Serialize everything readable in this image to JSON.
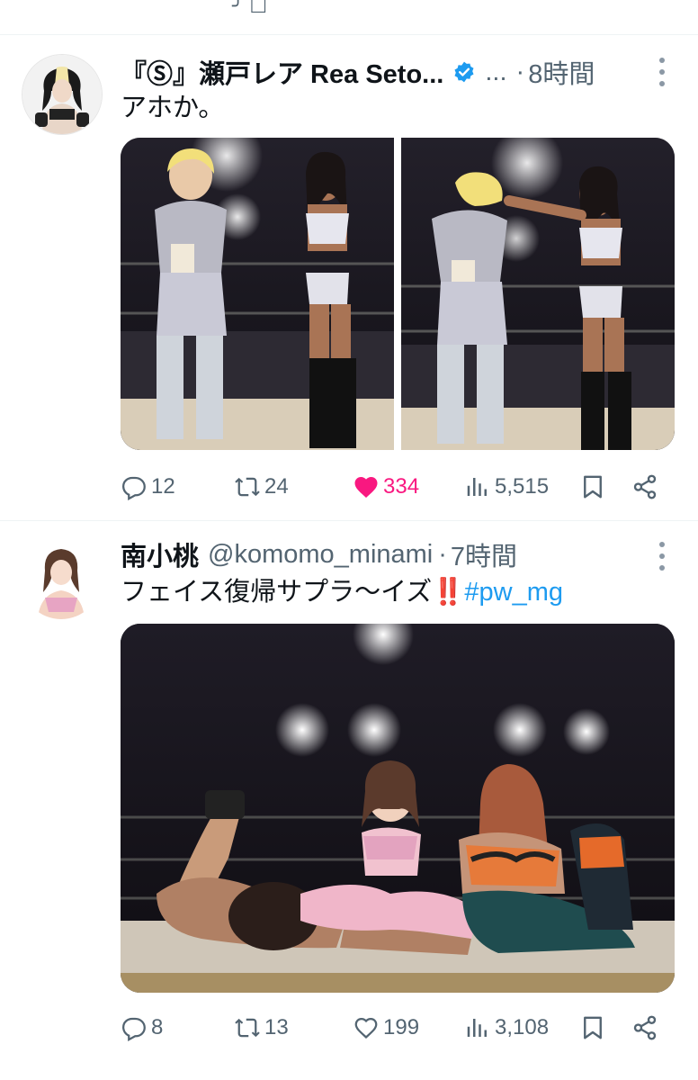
{
  "tweets": [
    {
      "display_name": "『Ⓢ』瀬戸レア Rea Seto...",
      "verified": true,
      "ellipsis": "...",
      "separator": "·",
      "time": "8時間",
      "text": "アホか。",
      "metrics": {
        "replies": "12",
        "retweets": "24",
        "likes": "334",
        "views": "5,515"
      },
      "liked": true
    },
    {
      "display_name": "南小桃",
      "handle": "@komomo_minami",
      "separator": "·",
      "time": "7時間",
      "text": "フェイス復帰サプラ〜イズ",
      "emoji": "‼️",
      "hashtag": "#pw_mg",
      "metrics": {
        "replies": "8",
        "retweets": "13",
        "likes": "199",
        "views": "3,108"
      },
      "liked": false
    }
  ],
  "icons": {
    "reply": "reply-icon",
    "retweet": "retweet-icon",
    "like": "heart-icon",
    "views": "views-icon",
    "bookmark": "bookmark-icon",
    "share": "share-icon",
    "more": "more-icon",
    "verified": "verified-badge-icon"
  },
  "colors": {
    "like_active": "#f91880",
    "link": "#1d9bf0",
    "muted": "#536471",
    "verified": "#1d9bf0"
  }
}
